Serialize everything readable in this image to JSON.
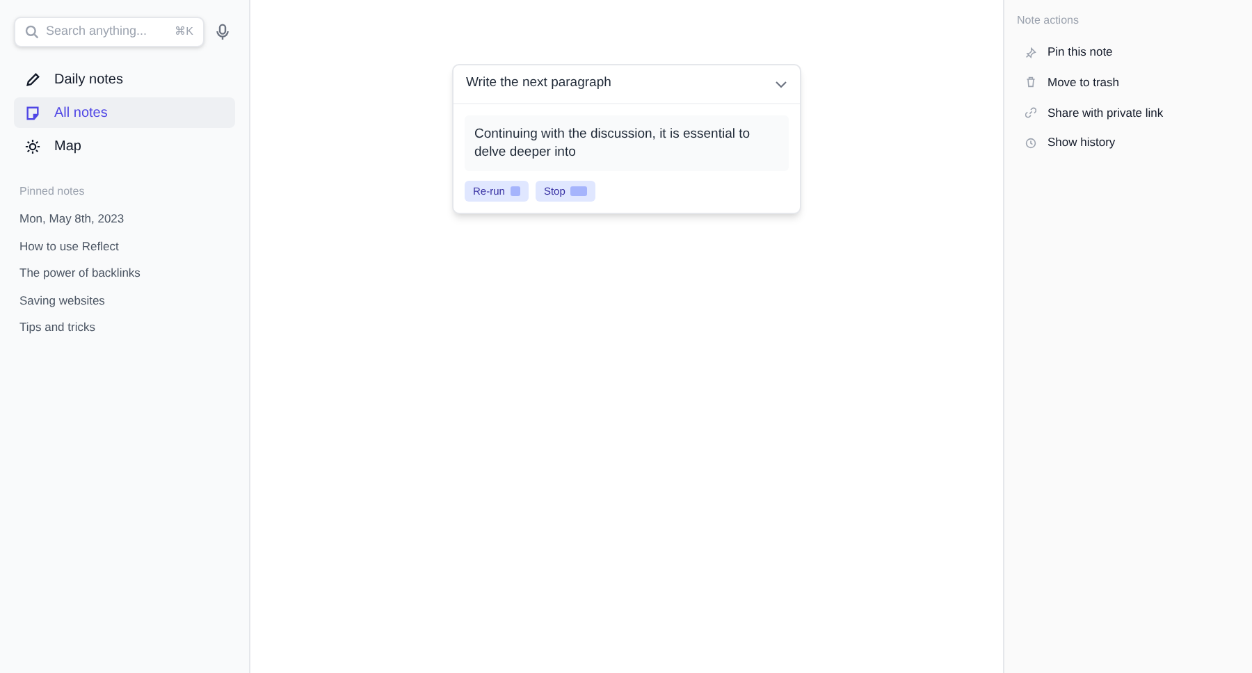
{
  "search": {
    "placeholder": "Search anything...",
    "shortcut": "⌘K"
  },
  "nav": [
    {
      "label": "Daily notes",
      "selected": false
    },
    {
      "label": "All notes",
      "selected": true
    },
    {
      "label": "Map",
      "selected": false
    }
  ],
  "pinned": {
    "title": "Pinned notes",
    "items": [
      "Mon, May 8th, 2023",
      "How to use Reflect",
      "The power of backlinks",
      "Saving websites",
      "Tips and tricks"
    ]
  },
  "prompt": {
    "title": "Write the next paragraph",
    "output": "Continuing with the discussion, it is essential to delve deeper into",
    "buttons": [
      "Re-run",
      "Stop"
    ]
  },
  "note_actions": {
    "title": "Note actions",
    "items": [
      "Pin this note",
      "Move to trash",
      "Share with private link",
      "Show history"
    ]
  }
}
